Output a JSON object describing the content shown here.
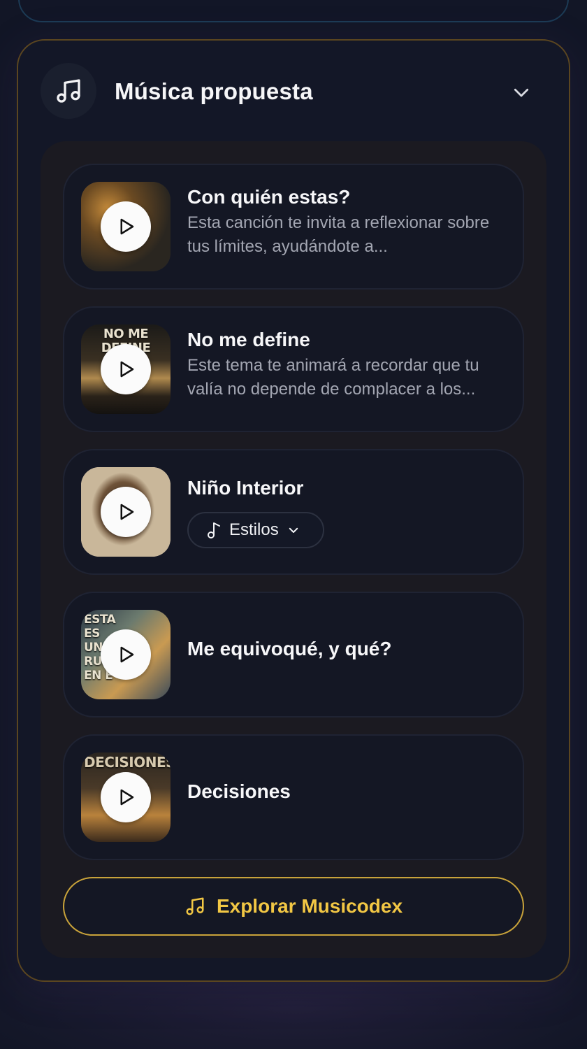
{
  "section": {
    "title": "Música propuesta",
    "icon": "music-note-icon",
    "toggle_icon": "chevron-down-icon",
    "accent_border": "#5b4620"
  },
  "tracks": [
    {
      "title": "Con quién estas?",
      "description": "Esta canción te invita a reflexionar sobre tus límites, ayudándote a...",
      "art_text": ""
    },
    {
      "title": "No me define",
      "description": "Este tema te animará a recordar que tu valía no depende de complacer a los...",
      "art_text": "NO ME DEFINE"
    },
    {
      "title": "Niño Interior",
      "styles_label": "Estilos",
      "art_text": ""
    },
    {
      "title": "Me equivoqué, y qué?",
      "art_text": "ESTA ES UNA RUINA EN E"
    },
    {
      "title": "Decisiones",
      "art_text": "DECISIONES"
    }
  ],
  "explore_button": {
    "label": "Explorar Musicodex",
    "color": "#f2c744"
  }
}
